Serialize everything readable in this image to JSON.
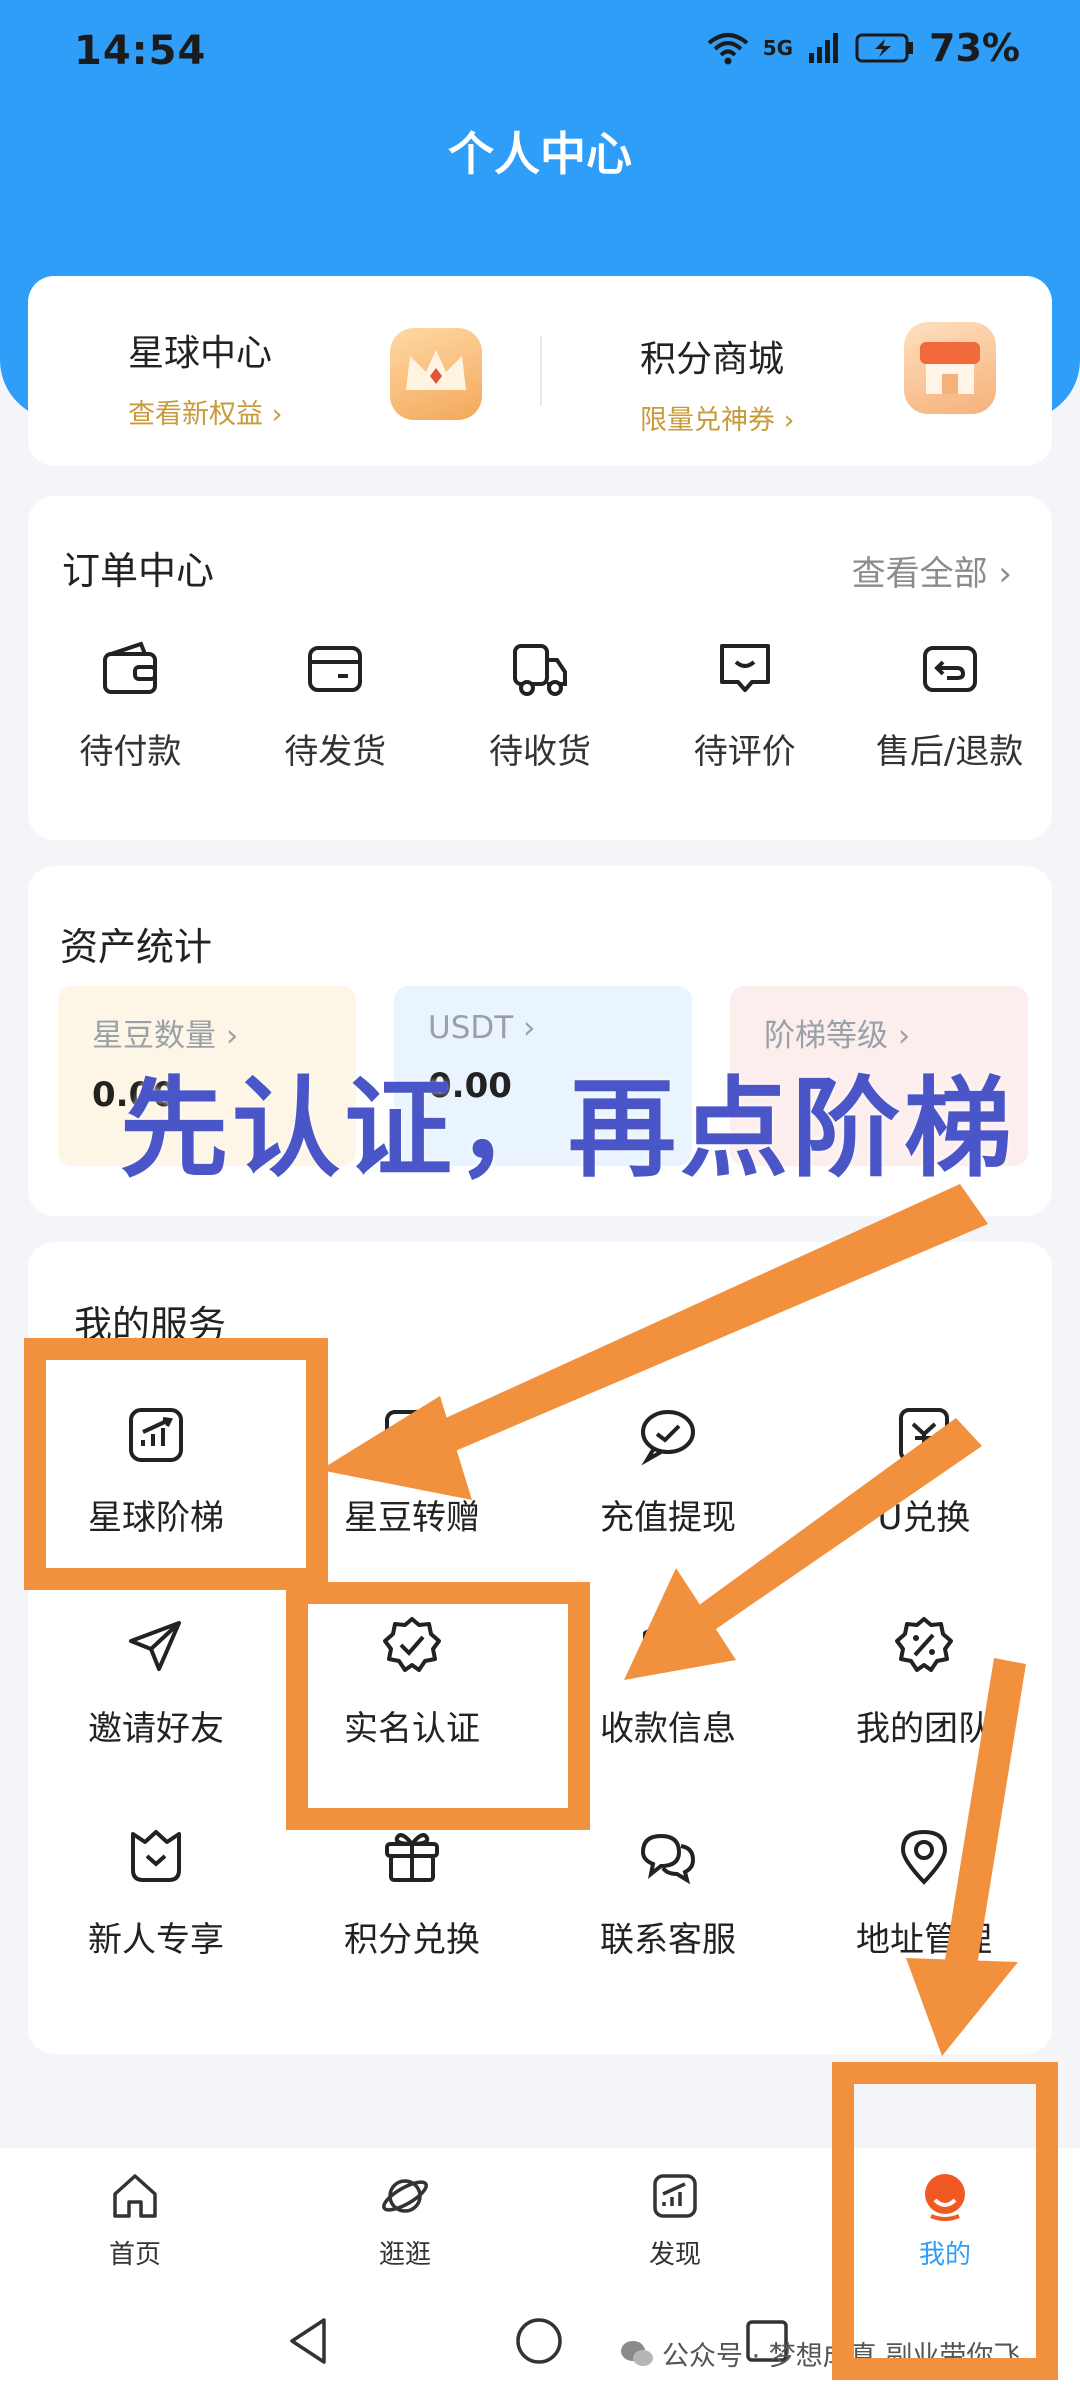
{
  "status": {
    "time": "14:54",
    "network": "5G",
    "battery": "73%"
  },
  "page": {
    "title": "个人中心"
  },
  "quick": [
    {
      "title": "星球中心",
      "sub": "查看新权益",
      "icon": "crown-icon"
    },
    {
      "title": "积分商城",
      "sub": "限量兑神券",
      "icon": "shop-icon"
    }
  ],
  "orders": {
    "title": "订单中心",
    "view_all": "查看全部",
    "items": [
      {
        "label": "待付款",
        "icon": "wallet-icon"
      },
      {
        "label": "待发货",
        "icon": "package-icon"
      },
      {
        "label": "待收货",
        "icon": "truck-icon"
      },
      {
        "label": "待评价",
        "icon": "comment-icon"
      },
      {
        "label": "售后/退款",
        "icon": "return-icon"
      }
    ]
  },
  "assets": {
    "title": "资产统计",
    "items": [
      {
        "label": "星豆数量",
        "value": "0.00",
        "color": "#fdf6e6"
      },
      {
        "label": "USDT",
        "value": "0.00",
        "color": "#eaf4fe"
      },
      {
        "label": "阶梯等级",
        "value": "",
        "color": "#fdeeee"
      }
    ]
  },
  "services": {
    "title": "我的服务",
    "items": [
      {
        "label": "星球阶梯",
        "icon": "chart-icon"
      },
      {
        "label": "星豆转赠",
        "icon": "card-icon"
      },
      {
        "label": "充值提现",
        "icon": "recharge-icon"
      },
      {
        "label": "U兑换",
        "icon": "exchange-icon"
      },
      {
        "label": "邀请好友",
        "icon": "send-icon"
      },
      {
        "label": "实名认证",
        "icon": "verified-icon"
      },
      {
        "label": "收款信息",
        "icon": "receipt-icon"
      },
      {
        "label": "我的团队",
        "icon": "discount-icon"
      },
      {
        "label": "新人专享",
        "icon": "gift-shield-icon"
      },
      {
        "label": "积分兑换",
        "icon": "gift-icon"
      },
      {
        "label": "联系客服",
        "icon": "chat-icon"
      },
      {
        "label": "地址管理",
        "icon": "location-icon"
      }
    ]
  },
  "tabs": [
    {
      "label": "首页",
      "icon": "home-icon"
    },
    {
      "label": "逛逛",
      "icon": "planet-icon"
    },
    {
      "label": "发现",
      "icon": "trend-icon"
    },
    {
      "label": "我的",
      "icon": "profile-icon",
      "active": true
    }
  ],
  "annotation": {
    "text": "先认证，再点阶梯",
    "color": "#f2913d"
  },
  "watermark": "公众号 · 梦想成真 副业带你飞"
}
